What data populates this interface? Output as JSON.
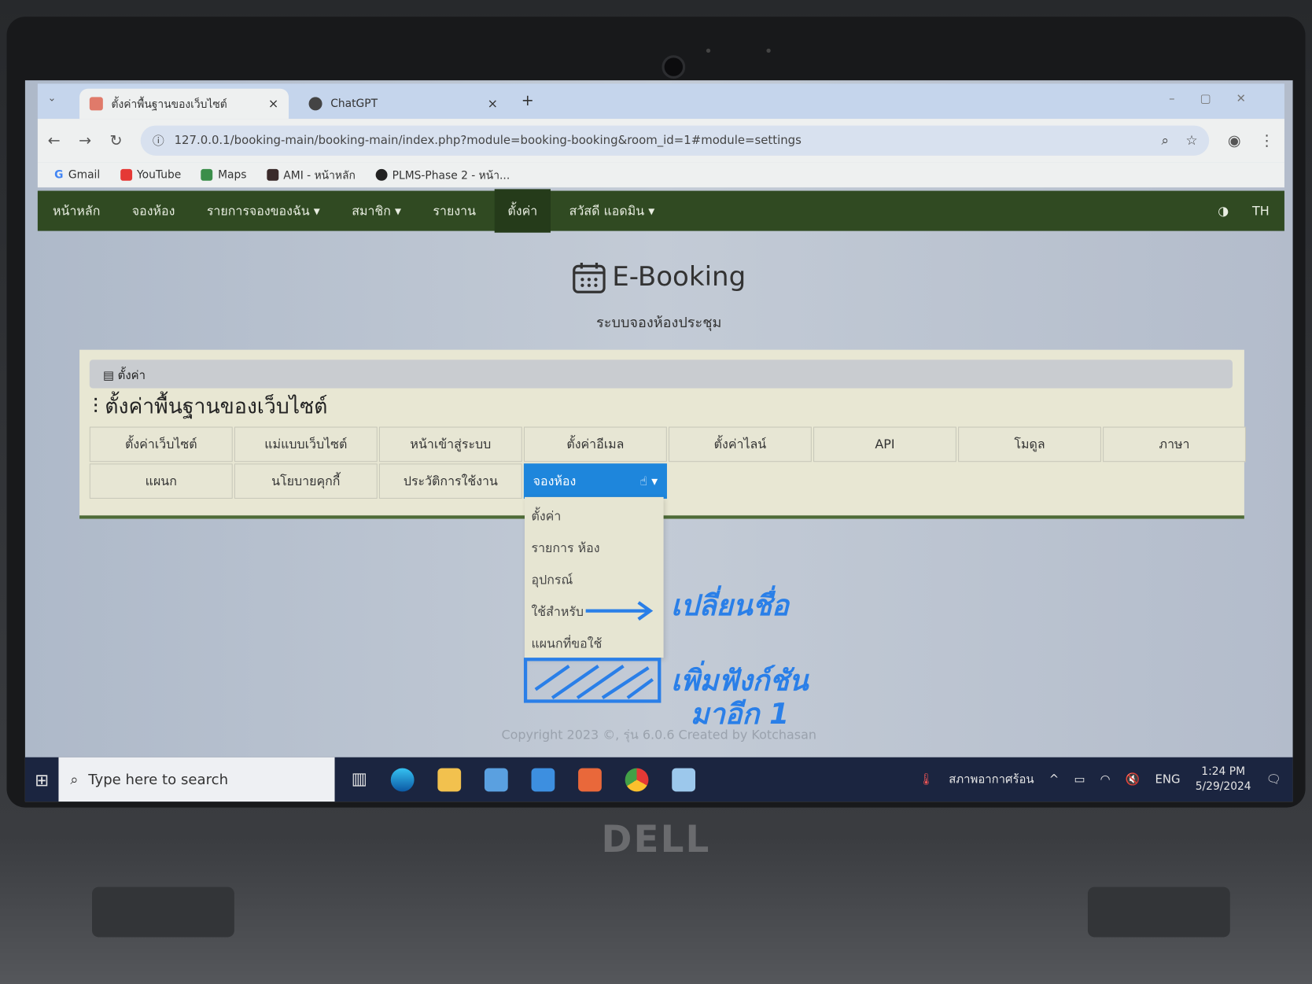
{
  "browser": {
    "tabs": [
      {
        "label": "ตั้งค่าพื้นฐานของเว็บไซต์",
        "active": true
      },
      {
        "label": "ChatGPT",
        "active": false
      }
    ],
    "new_tab": "+",
    "url": "127.0.0.1/booking-main/booking-main/index.php?module=booking-booking&room_id=1#module=settings",
    "bookmarks": [
      "Gmail",
      "YouTube",
      "Maps",
      "AMI - หน้าหลัก",
      "PLMS-Phase 2 - หน้า..."
    ]
  },
  "nav": {
    "items": [
      "หน้าหลัก",
      "จองห้อง",
      "รายการจองของฉัน ▾",
      "สมาชิก ▾",
      "รายงาน",
      "ตั้งค่า",
      "สวัสดี แอดมิน ▾"
    ],
    "active": "ตั้งค่า",
    "lang": "TH"
  },
  "brand": {
    "title": "E-Booking",
    "subtitle": "ระบบจองห้องประชุม"
  },
  "panel": {
    "breadcrumb": "ตั้งค่า",
    "title": "ตั้งค่าพื้นฐานของเว็บไซต์",
    "buttons": [
      "ตั้งค่าเว็บไซต์",
      "แม่แบบเว็บไซต์",
      "หน้าเข้าสู่ระบบ",
      "ตั้งค่าอีเมล",
      "ตั้งค่าไลน์",
      "API",
      "โมดูล",
      "ภาษา",
      "แผนก",
      "นโยบายคุกกี้",
      "ประวัติการใช้งาน"
    ],
    "dropdown": {
      "label": "จองห้อง",
      "items": [
        "ตั้งค่า",
        "รายการ ห้อง",
        "อุปกรณ์",
        "ใช้สำหรับ",
        "แผนกที่ขอใช้"
      ]
    }
  },
  "annotations": {
    "rename": "เปลี่ยนชื่อ",
    "add_line1": "เพิ่มฟังก์ชัน",
    "add_line2": "มาอีก 1"
  },
  "footer": "Copyright 2023 ©, รุ่น 6.0.6 Created by Kotchasan",
  "taskbar": {
    "search_placeholder": "Type here to search",
    "weather": "สภาพอากาศร้อน",
    "lang": "ENG",
    "time": "1:24 PM",
    "date": "5/29/2024"
  },
  "laptop_brand": "DELL",
  "colors": {
    "nav": "#304a22",
    "accent": "#1e86dc",
    "panel": "#e8e7d3",
    "annotation": "#2a7fe8"
  }
}
